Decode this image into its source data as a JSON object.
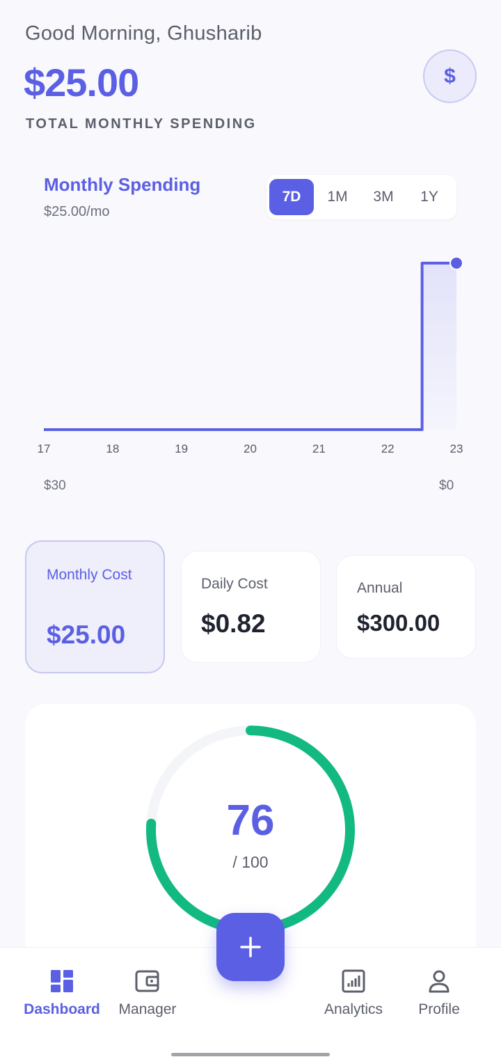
{
  "header": {
    "greeting": "Good Morning, Ghusharib",
    "total_amount": "$25.00",
    "total_label": "TOTAL MONTHLY SPENDING",
    "badge_symbol": "$"
  },
  "spending_chart": {
    "title": "Monthly Spending",
    "subtitle": "$25.00/mo",
    "range_options": [
      "7D",
      "1M",
      "3M",
      "1Y"
    ],
    "selected_range": "7D",
    "y_left_label": "$30",
    "y_right_label": "$0"
  },
  "chart_data": {
    "type": "line",
    "step": true,
    "x": [
      "17",
      "18",
      "19",
      "20",
      "21",
      "22",
      "23"
    ],
    "values": [
      0,
      0,
      0,
      0,
      0,
      0,
      25
    ],
    "ylim": [
      0,
      30
    ],
    "grid": false
  },
  "stats": {
    "monthly": {
      "label": "Monthly Cost",
      "value": "$25.00"
    },
    "daily": {
      "label": "Daily Cost",
      "value": "$0.82"
    },
    "annual": {
      "label": "Annual",
      "value": "$300.00"
    }
  },
  "score": {
    "value": "76",
    "max_label": "/ 100",
    "fraction": 0.76
  },
  "nav": {
    "items": [
      {
        "label": "Dashboard",
        "icon": "dashboard-icon"
      },
      {
        "label": "Manager",
        "icon": "wallet-icon"
      },
      {
        "label": "Analytics",
        "icon": "analytics-icon"
      },
      {
        "label": "Profile",
        "icon": "profile-icon"
      }
    ],
    "active": "Dashboard",
    "fab_icon": "plus-icon"
  },
  "colors": {
    "accent": "#5b5fe3",
    "score_ring": "#12b981",
    "text_muted": "#5b5f6b"
  }
}
